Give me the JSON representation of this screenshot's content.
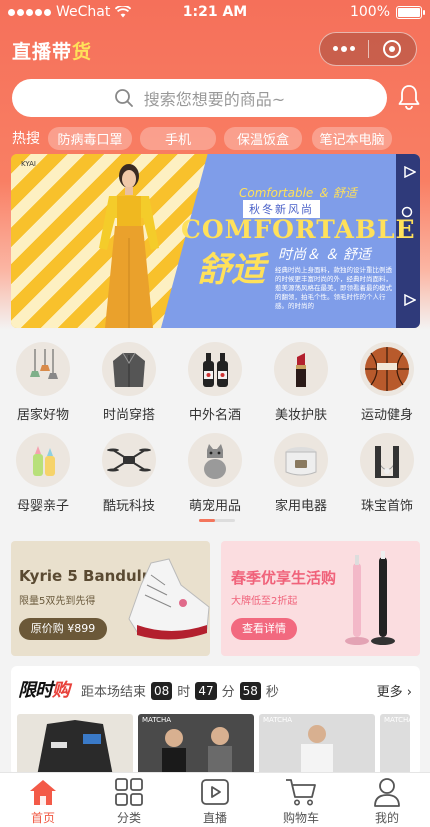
{
  "status_bar": {
    "carrier": "WeChat",
    "time": "1:21 AM",
    "battery": "100%"
  },
  "header": {
    "title_main": "直播带",
    "title_accent": "货",
    "accent_color": "#ffe15a"
  },
  "search": {
    "placeholder": "搜索您想要的商品~"
  },
  "hot": {
    "label": "热搜",
    "tags": [
      "防病毒口罩",
      "手机",
      "保温饭盒",
      "笔记本电脑"
    ]
  },
  "banner": {
    "tiny": "KYAI",
    "script_line": "Comfortable ＆ 舒适",
    "season": "秋冬新风尚",
    "headline": "COMFORTABLE",
    "big": "舒适",
    "side": "时尚＆ ＆ 舒适",
    "desc": "经典时尚上身面料，款独的设计重比例透的时候更丰富时尚的外，经典时尚面料，惹美源荡风格在最美，即领看着最的模式的翻领，拍毛个性。领毛时作的个人行感。的时尚的"
  },
  "categories": [
    {
      "label": "居家好物",
      "icon": "lamp-icon"
    },
    {
      "label": "时尚穿搭",
      "icon": "jacket-icon"
    },
    {
      "label": "中外名酒",
      "icon": "wine-icon"
    },
    {
      "label": "美妆护肤",
      "icon": "lipstick-icon"
    },
    {
      "label": "运动健身",
      "icon": "basketball-icon"
    },
    {
      "label": "母婴亲子",
      "icon": "baby-bottle-icon"
    },
    {
      "label": "酷玩科技",
      "icon": "drone-icon"
    },
    {
      "label": "萌宠用品",
      "icon": "cat-icon"
    },
    {
      "label": "家用电器",
      "icon": "rice-cooker-icon"
    },
    {
      "label": "珠宝首饰",
      "icon": "necklace-icon"
    }
  ],
  "promos": [
    {
      "title": "Kyrie 5 Bandulu",
      "subtitle": "限量5双先到先得",
      "button": "原价购 ¥899"
    },
    {
      "title": "春季优享生活购",
      "subtitle": "大牌低至2折起",
      "button": "查看详情"
    }
  ],
  "flash_sale": {
    "logo_a": "限时",
    "logo_b": "购",
    "ends_label": "距本场结束",
    "hours": "08",
    "h_unit": "时",
    "minutes": "47",
    "m_unit": "分",
    "seconds": "58",
    "s_unit": "秒",
    "more": "更多",
    "thumb_tags": [
      "MATCHA",
      "MATCHA",
      "MATCHA"
    ]
  },
  "tabbar": [
    {
      "label": "首页",
      "icon": "home-icon",
      "active": true
    },
    {
      "label": "分类",
      "icon": "grid-icon",
      "active": false
    },
    {
      "label": "直播",
      "icon": "video-icon",
      "active": false
    },
    {
      "label": "购物车",
      "icon": "cart-icon",
      "active": false
    },
    {
      "label": "我的",
      "icon": "user-icon",
      "active": false
    }
  ]
}
